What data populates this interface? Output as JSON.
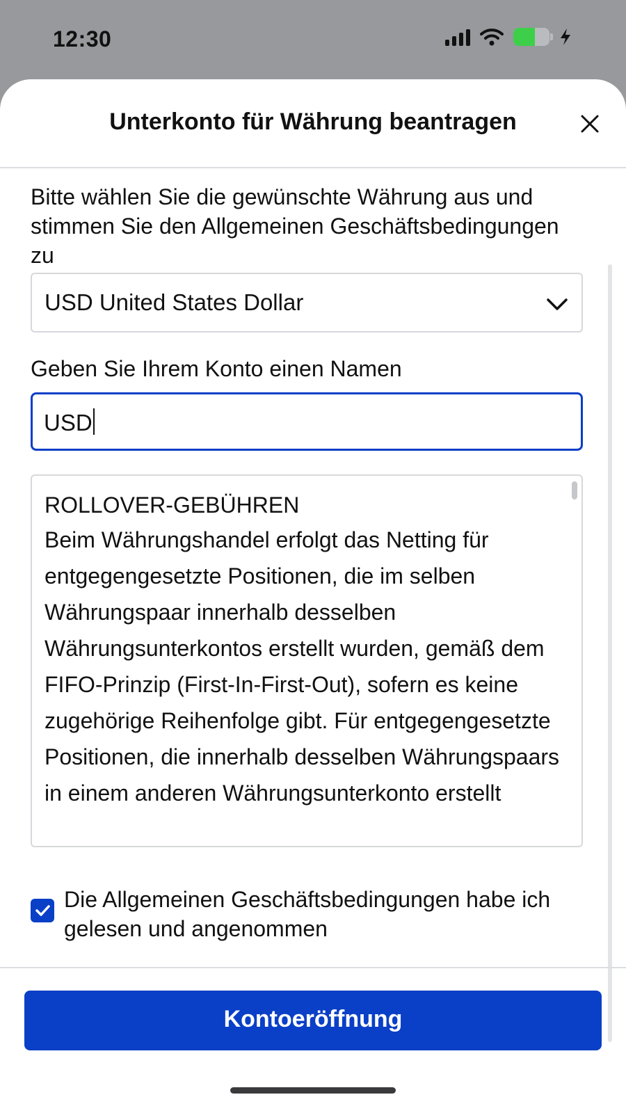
{
  "status_bar": {
    "time": "12:30",
    "icons": [
      "cellular-signal-icon",
      "wifi-icon",
      "battery-charging-icon"
    ],
    "battery_level": 0.6
  },
  "sheet": {
    "title": "Unterkonto für Währung beantragen",
    "close_icon": "close-icon"
  },
  "form": {
    "instruction": "Bitte wählen Sie die gewünschte Währung aus und stimmen Sie den Allgemeinen Geschäftsbedingungen zu",
    "currency_select": {
      "value": "USD United States Dollar",
      "icon": "chevron-down-icon"
    },
    "account_name": {
      "label": "Geben Sie Ihrem Konto einen Namen",
      "value": "USD"
    },
    "terms": {
      "heading": "ROLLOVER-GEBÜHREN",
      "body": "Beim Währungshandel erfolgt das Netting für entgegengesetzte Positionen, die im selben Währungspaar innerhalb desselben Währungsunterkontos erstellt wurden, gemäß dem FIFO-Prinzip (First-In-First-Out), sofern es keine zugehörige Reihenfolge gibt. Für entgegengesetzte Positionen, die innerhalb desselben Währungspaars in einem anderen Währungsunterkonto erstellt"
    },
    "accept": {
      "checked": true,
      "label": "Die Allgemeinen Geschäftsbedingungen habe ich gelesen und angenommen"
    }
  },
  "footer": {
    "submit_label": "Kontoeröffnung"
  },
  "colors": {
    "accent": "#0a3fc7",
    "backdrop": "#97999c",
    "battery": "#3ecf4a"
  }
}
